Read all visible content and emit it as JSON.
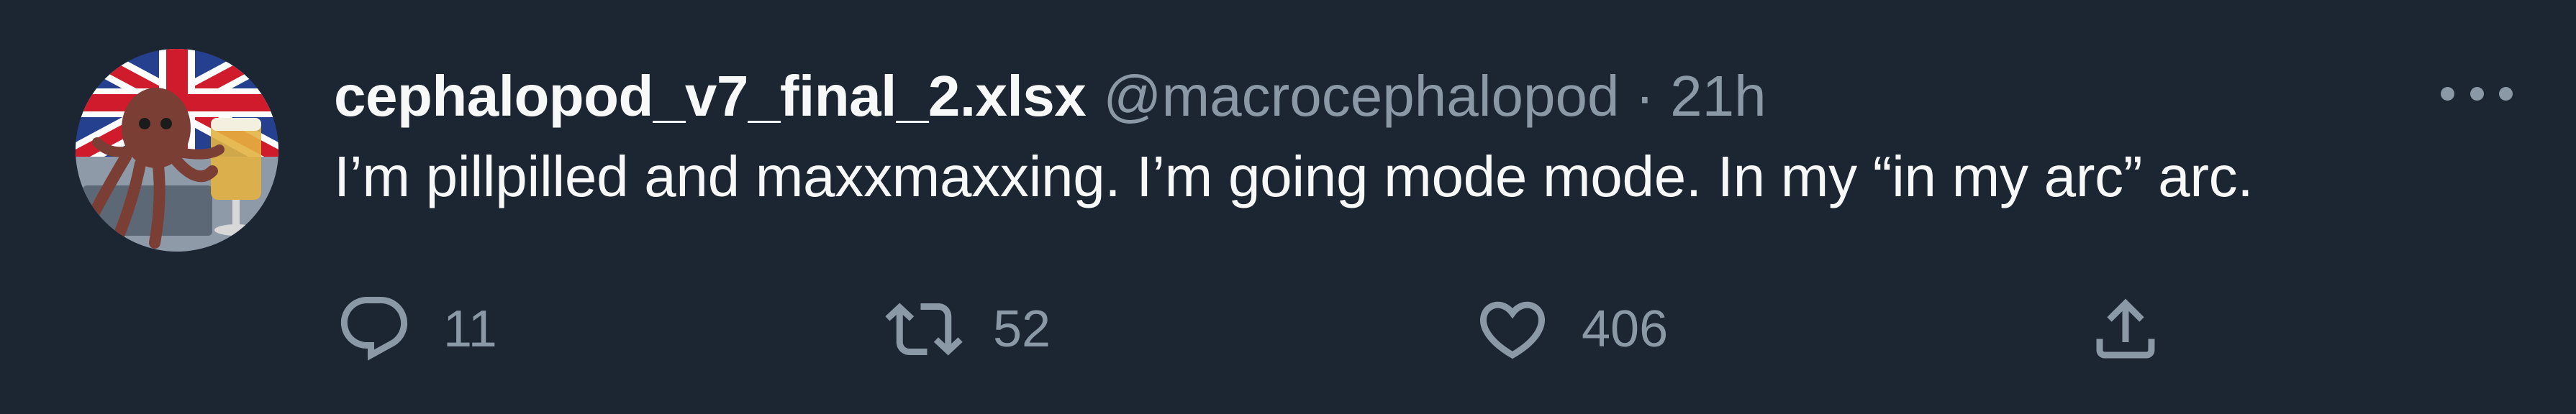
{
  "tweet": {
    "display_name": "cephalopod_v7_final_2.xlsx",
    "handle": "@macrocephalopod",
    "separator": "·",
    "time": "21h",
    "text": "I’m pillpilled and maxxmaxxing. I’m going mode mode. In my “in my arc” arc.",
    "more_icon": "more-horizontal-icon"
  },
  "actions": {
    "reply": {
      "icon": "reply-icon",
      "count": "11"
    },
    "retweet": {
      "icon": "retweet-icon",
      "count": "52"
    },
    "like": {
      "icon": "heart-icon",
      "count": "406"
    },
    "share": {
      "icon": "share-icon"
    }
  },
  "colors": {
    "background": "#1c2532",
    "text_primary": "#f7f9f9",
    "text_secondary": "#8b98a5"
  }
}
